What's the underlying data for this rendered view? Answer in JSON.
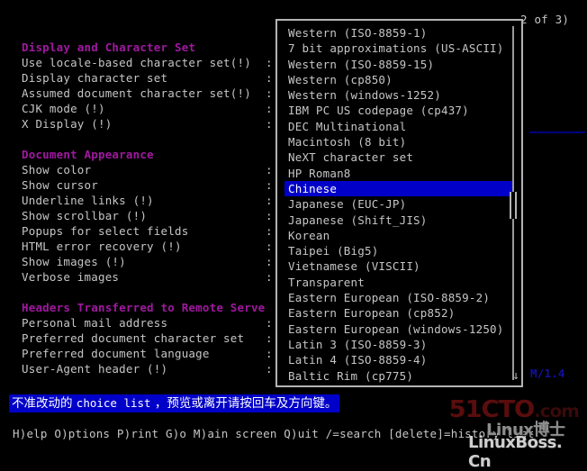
{
  "app": {
    "name": "lynx-options-form",
    "page_indicator": "2 of 3)",
    "colors": {
      "background": "#000000",
      "foreground": "#c6c6c6",
      "heading": "#a018a0",
      "highlight_bg": "#0000c8",
      "highlight_fg": "#ffffff",
      "box_border": "#b4b4b4",
      "dim_blue": "#11119e"
    }
  },
  "form": {
    "groups": [
      {
        "title": "Display and Character Set",
        "rows": [
          {
            "label": "Use locale-based character set(!)",
            "colon": ":",
            "value": ""
          },
          {
            "label": "Display character set",
            "colon": ":",
            "value": ""
          },
          {
            "label": "Assumed document character set(!)",
            "colon": ":",
            "value": ""
          },
          {
            "label": "CJK mode (!)",
            "colon": ":",
            "value": ""
          },
          {
            "label": "X Display (!)",
            "colon": ":",
            "value": ""
          }
        ]
      },
      {
        "title": "Document Appearance",
        "rows": [
          {
            "label": "Show color",
            "colon": ":",
            "value": ""
          },
          {
            "label": "Show cursor",
            "colon": ":",
            "value": ""
          },
          {
            "label": "Underline links (!)",
            "colon": ":",
            "value": ""
          },
          {
            "label": "Show scrollbar (!)",
            "colon": ":",
            "value": ""
          },
          {
            "label": "Popups for select fields",
            "colon": ":",
            "value": ""
          },
          {
            "label": "HTML error recovery (!)",
            "colon": ":",
            "value": ""
          },
          {
            "label": "Show images (!)",
            "colon": ":",
            "value": ""
          },
          {
            "label": "Verbose images",
            "colon": ":",
            "value": ""
          }
        ]
      },
      {
        "title": "Headers Transferred to Remote Serve",
        "rows": [
          {
            "label": "Personal mail address",
            "colon": ":",
            "value": ""
          },
          {
            "label": "Preferred document character set",
            "colon": ":",
            "value": ""
          },
          {
            "label": "Preferred document language",
            "colon": ":",
            "value": ""
          },
          {
            "label": "User-Agent header (!)",
            "colon": ":",
            "value": ""
          }
        ]
      }
    ]
  },
  "popup": {
    "name": "character-set-choice-list",
    "selected": "Chinese",
    "selected_index": 14,
    "scroll_down_glyph": "↓",
    "options": [
      "Western (ISO-8859-1)",
      "7 bit approximations (US-ASCII)",
      "Western (ISO-8859-15)",
      "Western (cp850)",
      "Western (windows-1252)",
      "IBM PC US codepage (cp437)",
      "DEC Multinational",
      "Macintosh (8 bit)",
      "NeXT character set",
      "HP Roman8",
      "Chinese",
      "Japanese (EUC-JP)",
      "Japanese (Shift_JIS)",
      "Korean",
      "Taipei (Big5)",
      "Vietnamese (VISCII)",
      "Transparent",
      "Eastern European (ISO-8859-2)",
      "Eastern European (cp852)",
      "Eastern European (windows-1250)",
      "Latin 3 (ISO-8859-3)",
      "Latin 4 (ISO-8859-4)",
      "Baltic Rim (cp775)"
    ]
  },
  "remnants": {
    "dim_text": "M/1.4"
  },
  "status": {
    "prefix": "不准改动的 ",
    "mono": "choice list",
    "suffix": " ，预览或离开请按回车及方向键。"
  },
  "keybar": {
    "text": "H)elp O)ptions P)rint G)o M)ain screen Q)uit /=search [delete]=history list"
  },
  "watermark": {
    "primary_big": "51CTO",
    "primary_small": ".com",
    "secondary": "Linux博士",
    "tertiary": "LinuxBoss. Cn"
  }
}
